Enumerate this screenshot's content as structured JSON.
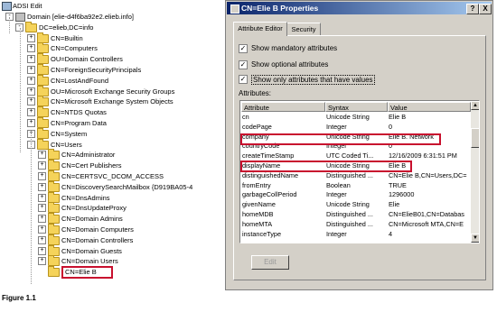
{
  "tree": {
    "root": "ADSI Edit",
    "domain": "Domain [elie-d4f6ba92e2.elieb.info]",
    "dc": "DC=elieb,DC=info",
    "items_level3": [
      "CN=Builtin",
      "CN=Computers",
      "OU=Domain Controllers",
      "CN=ForeignSecurityPrincipals",
      "CN=LostAndFound",
      "OU=Microsoft Exchange Security Groups",
      "CN=Microsoft Exchange System Objects",
      "CN=NTDS Quotas",
      "CN=Program Data",
      "CN=System",
      "CN=Users"
    ],
    "items_users": [
      "CN=Administrator",
      "CN=Cert Publishers",
      "CN=CERTSVC_DCOM_ACCESS",
      "CN=DiscoverySearchMailbox {D919BA05-4",
      "CN=DnsAdmins",
      "CN=DnsUpdateProxy",
      "CN=Domain Admins",
      "CN=Domain Computers",
      "CN=Domain Controllers",
      "CN=Domain Guests",
      "CN=Domain Users",
      "CN=Elie B"
    ]
  },
  "dialog": {
    "title": "CN=Elie B Properties",
    "help_btn": "?",
    "close_btn": "X",
    "tabs": [
      "Attribute Editor",
      "Security"
    ],
    "checks": [
      {
        "label": "Show mandatory attributes",
        "checked": true
      },
      {
        "label": "Show optional attributes",
        "checked": true
      },
      {
        "label": "Show only attributes that have values",
        "checked": true
      }
    ],
    "attributes_label": "Attributes:",
    "columns": [
      "Attribute",
      "Syntax",
      "Value"
    ],
    "rows": [
      [
        "cn",
        "Unicode String",
        "Elie B"
      ],
      [
        "codePage",
        "Integer",
        "0"
      ],
      [
        "company",
        "Unicode String",
        "Elie B. Network"
      ],
      [
        "countryCode",
        "Integer",
        "0"
      ],
      [
        "createTimeStamp",
        "UTC Coded Ti...",
        "12/16/2009 6:31:51 PM"
      ],
      [
        "displayName",
        "Unicode String",
        "Elie B"
      ],
      [
        "distinguishedName",
        "Distinguished ...",
        "CN=Elie B,CN=Users,DC="
      ],
      [
        "fromEntry",
        "Boolean",
        "TRUE"
      ],
      [
        "garbageCollPeriod",
        "Integer",
        "1296000"
      ],
      [
        "givenName",
        "Unicode String",
        "Elie"
      ],
      [
        "homeMDB",
        "Distinguished ...",
        "CN=ElieB01,CN=Databas"
      ],
      [
        "homeMTA",
        "Distinguished ...",
        "CN=Microsoft MTA,CN=E"
      ],
      [
        "instanceType",
        "Integer",
        "4"
      ]
    ],
    "edit_button": "Edit"
  },
  "caption": "Figure 1.1",
  "colors": {
    "highlight": "#c8102e",
    "titlebar": "#0a246a",
    "folder": "#f5d35a"
  }
}
